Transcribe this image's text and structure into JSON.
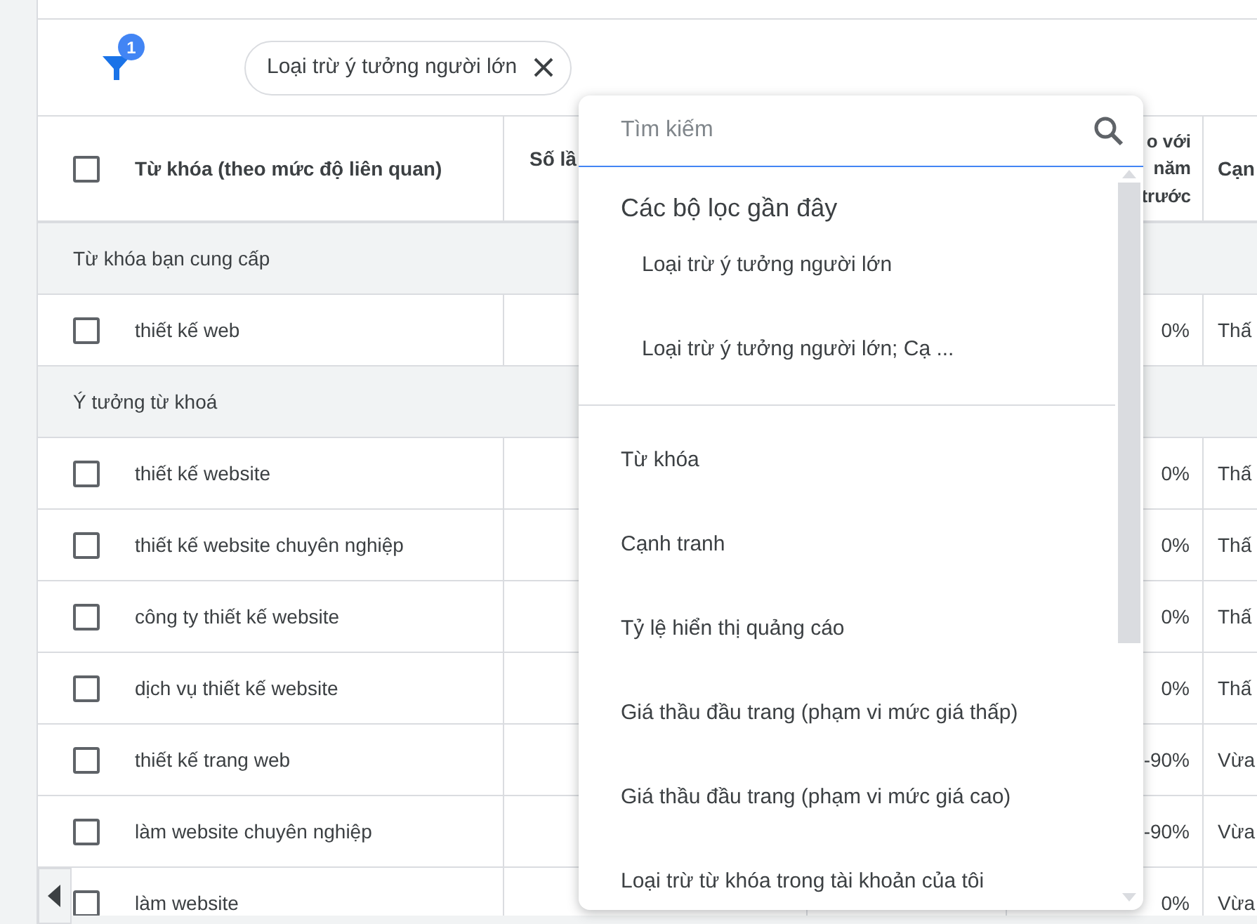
{
  "filter_bar": {
    "filter_count": "1",
    "chips": [
      {
        "label": "Loại trừ ý tưởng người lớn"
      }
    ]
  },
  "table": {
    "header_checked": false,
    "columns": [
      "Từ khóa (theo mức độ liên quan)",
      "Số lầ",
      "o với năm trước",
      "Cạn"
    ],
    "rows": [
      {
        "kind": "group",
        "label": "Từ khóa bạn cung cấp"
      },
      {
        "kind": "keyword",
        "checked": false,
        "keyword": "thiết kế web",
        "change": "0%",
        "column_5": "Thấ"
      },
      {
        "kind": "group",
        "label": "Ý tưởng từ khoá"
      },
      {
        "kind": "keyword",
        "checked": false,
        "keyword": "thiết kế website",
        "change": "0%",
        "column_5": "Thấ"
      },
      {
        "kind": "keyword",
        "checked": false,
        "keyword": "thiết kế website chuyên nghiệp",
        "change": "0%",
        "column_5": "Thấ"
      },
      {
        "kind": "keyword",
        "checked": false,
        "keyword": "công ty thiết kế website",
        "change": "0%",
        "column_5": "Thấ"
      },
      {
        "kind": "keyword",
        "checked": false,
        "keyword": "dịch vụ thiết kế website",
        "change": "0%",
        "column_5": "Thấ"
      },
      {
        "kind": "keyword",
        "checked": false,
        "keyword": "thiết kế trang web",
        "change": "-90%",
        "column_5": "Vừa"
      },
      {
        "kind": "keyword",
        "checked": false,
        "keyword": "làm website chuyên nghiệp",
        "change": "-90%",
        "column_5": "Vừa"
      },
      {
        "kind": "keyword",
        "checked": false,
        "keyword": "làm website",
        "change": "0%",
        "column_5": "Vừa"
      }
    ]
  },
  "filter_menu": {
    "search_placeholder": "Tìm kiếm",
    "recent_heading": "Các bộ lọc gần đây",
    "recent": [
      "Loại trừ ý tưởng người lớn",
      "Loại trừ ý tưởng người lớn; Cạ ..."
    ],
    "options": [
      "Từ khóa",
      "Cạnh tranh",
      "Tỷ lệ hiển thị quảng cáo",
      "Giá thầu đầu trang (phạm vi mức giá thấp)",
      "Giá thầu đầu trang (phạm vi mức giá cao)",
      "Loại trừ từ khóa trong tài khoản của tôi"
    ]
  }
}
